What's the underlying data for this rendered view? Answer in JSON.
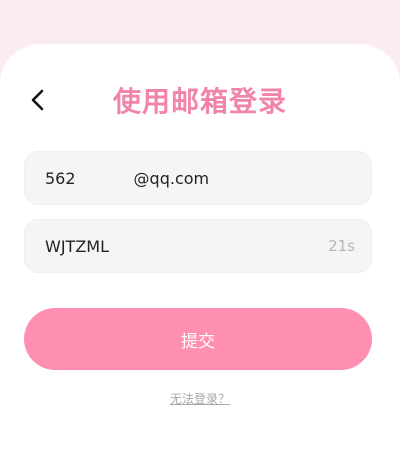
{
  "header": {
    "back_icon": "chevron-left-icon",
    "title": "使用邮箱登录"
  },
  "form": {
    "email_prefix": "562",
    "email_suffix": "@qq.com",
    "code_value": "WJTZML",
    "countdown": "21s",
    "submit_label": "提交"
  },
  "footer": {
    "help_link": "无法登录？"
  },
  "colors": {
    "accent": "#f284ab",
    "button": "#ff8fb0",
    "background": "#fbecef",
    "field_background": "#f6f5f5"
  }
}
